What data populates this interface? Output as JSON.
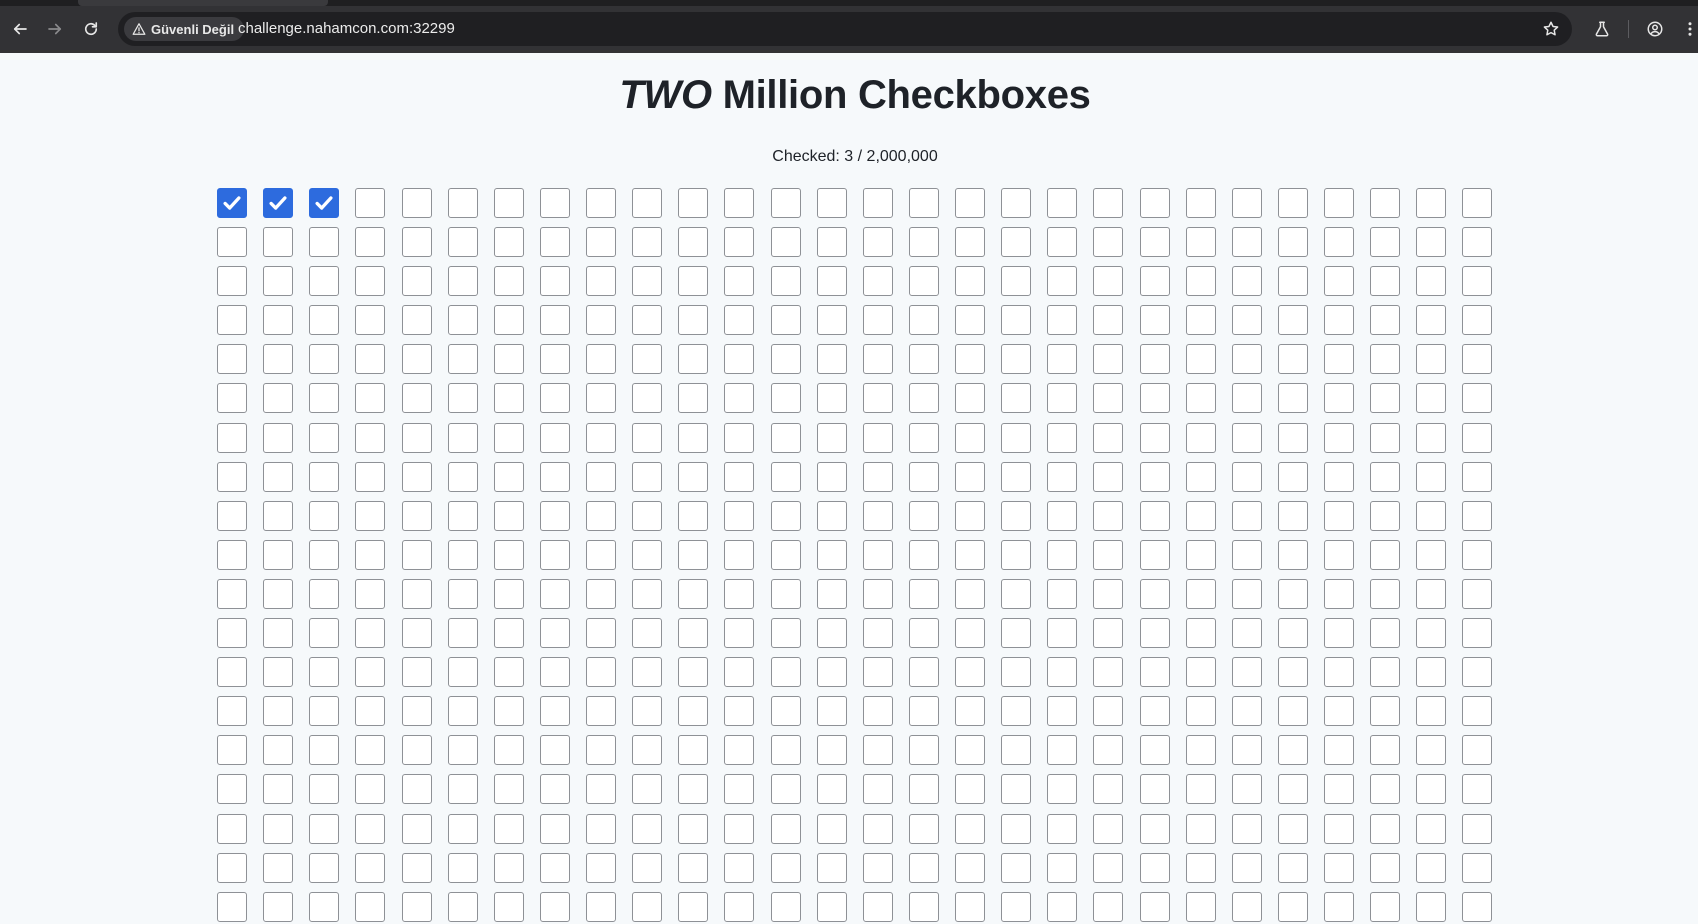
{
  "browser": {
    "security_label": "Güvenli Değil",
    "url": "challenge.nahamcon.com:32299",
    "icons": {
      "back": "arrow-left-icon",
      "forward": "arrow-right-icon",
      "reload": "reload-icon",
      "warning": "warning-triangle-icon",
      "bookmark": "star-icon",
      "labs": "flask-icon",
      "profile": "profile-icon",
      "menu": "kebab-menu-icon"
    }
  },
  "page": {
    "title_emphasis": "TWO",
    "title_rest": " Million Checkboxes",
    "checked_label": "Checked: 3 / 2,000,000"
  },
  "checkbox_grid": {
    "visible_columns": 28,
    "visible_rows": 19,
    "checked_indices": [
      0,
      1,
      2
    ],
    "checked_color": "#2d6bde"
  }
}
